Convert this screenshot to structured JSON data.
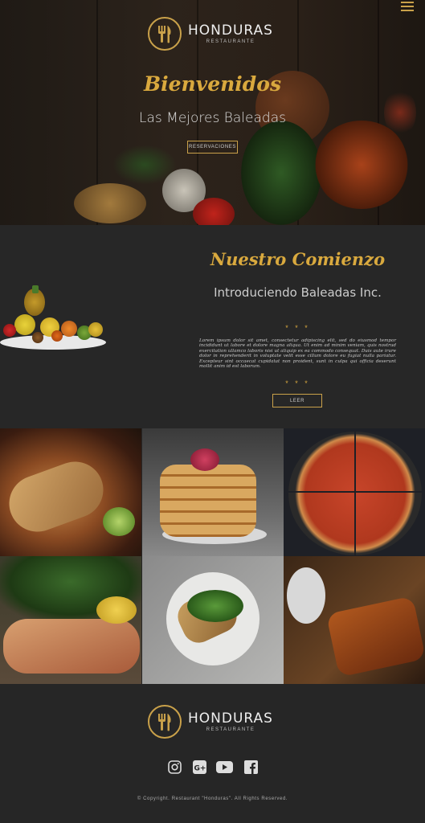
{
  "brand": {
    "name": "HONDURAS",
    "subtitle": "RESTAURANTE"
  },
  "nav": {
    "menu_icon": "hamburger-menu-icon"
  },
  "hero": {
    "title": "Bienvenidos",
    "subtitle": "Las Mejores Baleadas",
    "button_label": "RESERVACIONES"
  },
  "about": {
    "title": "Nuestro Comienzo",
    "subtitle": "Introduciendo Baleadas Inc.",
    "stars": "* * *",
    "body": "Lorem ipsum dolor sit amet, consectetur adipiscing elit, sed do eiusmod tempor incididunt ut labore et dolore magna aliqua. Ut enim ad minim veniam, quis nostrud exercitation ullamco laboris nisi ut aliquip ex ea commodo consequat. Duis aute irure dolor in reprehenderit in voluptate velit esse cillum dolore eu fugiat nulla pariatur. Excepteur sint occaecat cupidatat non proident, sunt in culpa qui officia deserunt mollit anim id est laborum.",
    "button_label": "LEER"
  },
  "gallery": {
    "items": [
      "burrito-photo",
      "pancakes-photo",
      "pizza-photo",
      "salmon-photo",
      "toast-photo",
      "grilled-fish-photo"
    ]
  },
  "footer": {
    "social_icons": [
      "instagram-icon",
      "google-plus-icon",
      "youtube-icon",
      "facebook-icon"
    ],
    "copyright": "© Copyright. Restaurant \"Honduras\". All Rights Reserved."
  },
  "colors": {
    "accent": "#d9a93e",
    "background": "#262626"
  }
}
